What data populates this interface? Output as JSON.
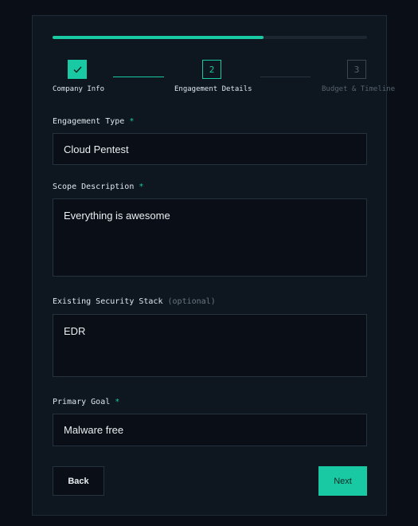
{
  "progress": {
    "fraction": 0.67
  },
  "steps": [
    {
      "number": "1",
      "label": "Company Info",
      "state": "done",
      "icon": "check-icon"
    },
    {
      "number": "2",
      "label": "Engagement Details",
      "state": "current"
    },
    {
      "number": "3",
      "label": "Budget & Timeline",
      "state": "pending"
    }
  ],
  "fields": {
    "engagement_type": {
      "label": "Engagement Type",
      "required_mark": "*",
      "value": "Cloud Pentest"
    },
    "scope_description": {
      "label": "Scope Description",
      "required_mark": "*",
      "value": "Everything is awesome"
    },
    "security_stack": {
      "label": "Existing Security Stack",
      "optional_note": "(optional)",
      "value": "EDR"
    },
    "primary_goal": {
      "label": "Primary Goal",
      "required_mark": "*",
      "value": "Malware free"
    }
  },
  "buttons": {
    "back": "Back",
    "next": "Next"
  },
  "colors": {
    "accent": "#19c9a3",
    "background": "#0a0f17",
    "card": "#0e1620"
  }
}
